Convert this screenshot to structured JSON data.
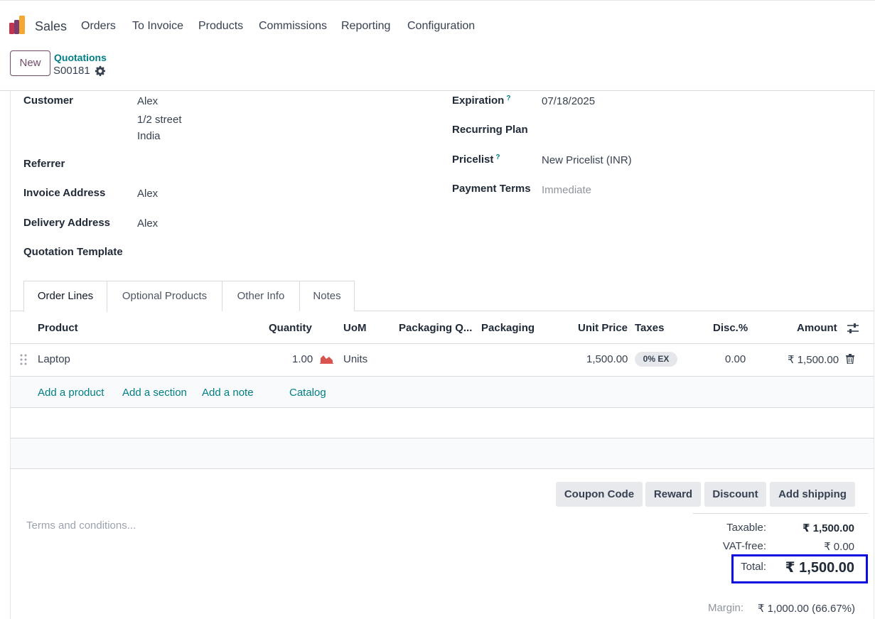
{
  "nav": {
    "app_name": "Sales",
    "menu": [
      "Orders",
      "To Invoice",
      "Products",
      "Commissions",
      "Reporting",
      "Configuration"
    ]
  },
  "control": {
    "new_label": "New",
    "breadcrumb_parent": "Quotations",
    "breadcrumb_current": "S00181"
  },
  "form": {
    "customer_label": "Customer",
    "customer_name": "Alex",
    "customer_street": "1/2 street",
    "customer_country": "India",
    "referrer_label": "Referrer",
    "invoice_address_label": "Invoice Address",
    "invoice_address": "Alex",
    "delivery_address_label": "Delivery Address",
    "delivery_address": "Alex",
    "template_label": "Quotation Template",
    "expiration_label": "Expiration",
    "expiration": "07/18/2025",
    "recurring_label": "Recurring Plan",
    "pricelist_label": "Pricelist",
    "pricelist": "New Pricelist (INR)",
    "payment_terms_label": "Payment Terms",
    "payment_terms": "Immediate",
    "help_mark": "?"
  },
  "tabs": [
    "Order Lines",
    "Optional Products",
    "Other Info",
    "Notes"
  ],
  "table": {
    "headers": {
      "product": "Product",
      "quantity": "Quantity",
      "uom": "UoM",
      "packaging_qty": "Packaging Q...",
      "packaging": "Packaging",
      "unit_price": "Unit Price",
      "taxes": "Taxes",
      "discount": "Disc.%",
      "amount": "Amount"
    },
    "rows": [
      {
        "product": "Laptop",
        "quantity": "1.00",
        "uom": "Units",
        "unit_price": "1,500.00",
        "tax": "0% EX",
        "discount": "0.00",
        "amount": "₹ 1,500.00"
      }
    ],
    "add_links": {
      "product": "Add a product",
      "section": "Add a section",
      "note": "Add a note",
      "catalog": "Catalog"
    }
  },
  "actions": {
    "coupon": "Coupon Code",
    "reward": "Reward",
    "discount": "Discount",
    "shipping": "Add shipping"
  },
  "terms_placeholder": "Terms and conditions...",
  "totals": {
    "taxable_label": "Taxable:",
    "taxable": "₹ 1,500.00",
    "vatfree_label": "VAT-free:",
    "vatfree": "₹ 0.00",
    "total_label": "Total:",
    "total": "₹ 1,500.00",
    "margin_label": "Margin:",
    "margin": "₹ 1,000.00 (66.67%)"
  },
  "colors": {
    "brand": "#714b67",
    "link": "#017e84",
    "highlight": "#0c0ce0",
    "forecast_icon": "#d9534f"
  }
}
